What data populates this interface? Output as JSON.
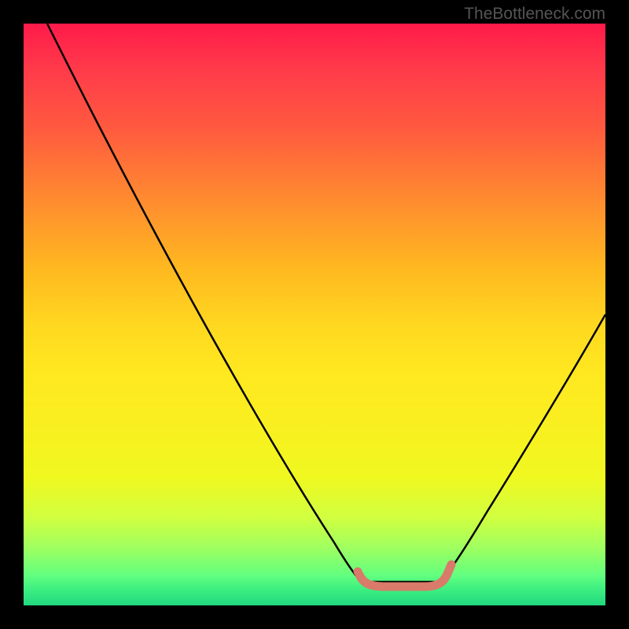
{
  "watermark": "TheBottleneck.com",
  "chart_data": {
    "type": "line",
    "title": "",
    "xlabel": "",
    "ylabel": "",
    "xlim": [
      0,
      100
    ],
    "ylim": [
      0,
      100
    ],
    "background_gradient": {
      "direction": "vertical",
      "stops": [
        {
          "pos": 0,
          "color": "#ff1a4a"
        },
        {
          "pos": 30,
          "color": "#ff8a30"
        },
        {
          "pos": 60,
          "color": "#ffe820"
        },
        {
          "pos": 100,
          "color": "#20d880"
        }
      ]
    },
    "series": [
      {
        "name": "bottleneck-curve",
        "color": "#000000",
        "x": [
          4,
          10,
          20,
          30,
          40,
          50,
          56,
          58,
          72,
          74,
          80,
          90,
          100
        ],
        "y": [
          100,
          90,
          72,
          54,
          36,
          18,
          6,
          4,
          4,
          6,
          16,
          35,
          55
        ]
      },
      {
        "name": "optimal-range",
        "color": "#d97a6a",
        "style": "thick",
        "x": [
          57,
          58,
          60,
          66,
          70,
          72,
          73
        ],
        "y": [
          6.5,
          4,
          3.5,
          3.5,
          3.5,
          4.5,
          7
        ]
      }
    ],
    "markers": [
      {
        "name": "optimal-start-dot",
        "x": 57,
        "y": 6.5,
        "color": "#d97a6a"
      }
    ]
  }
}
